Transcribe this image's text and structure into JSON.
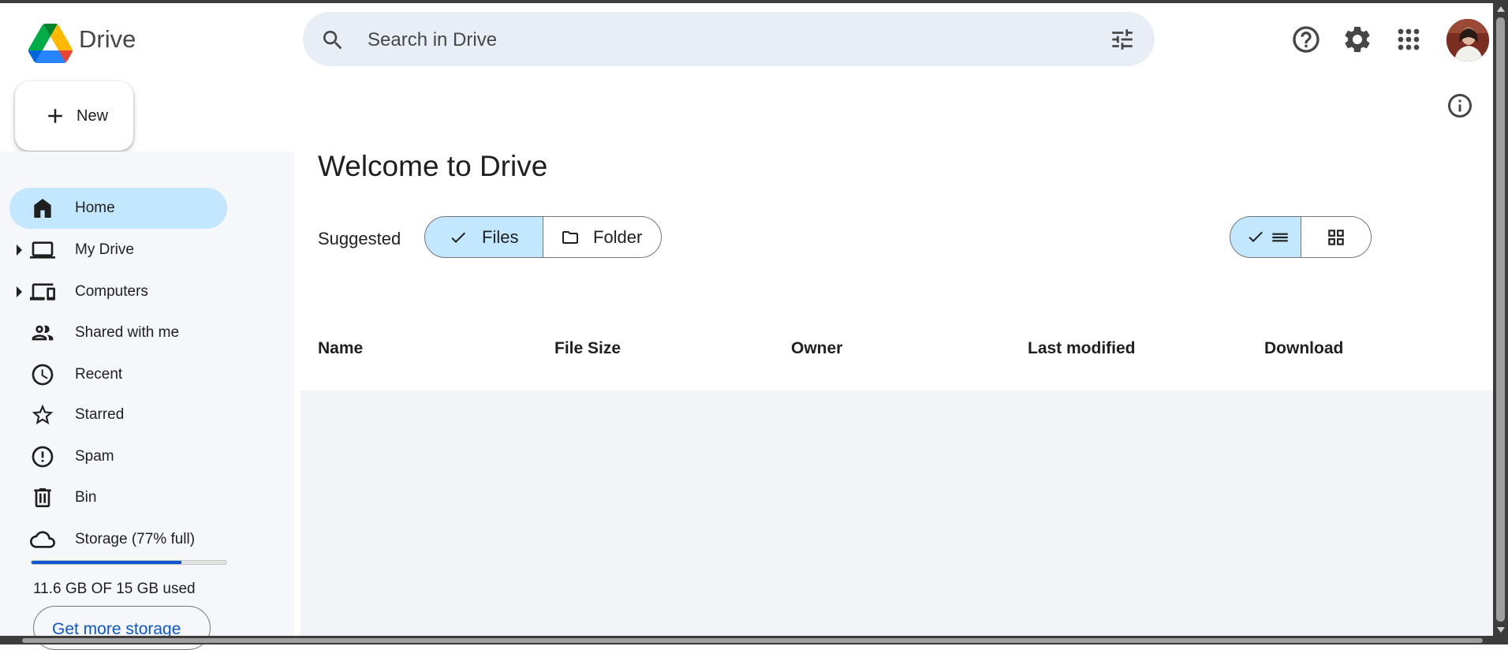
{
  "app": {
    "name": "Drive"
  },
  "search": {
    "placeholder": "Search in Drive"
  },
  "new_button": {
    "label": "New"
  },
  "sidebar": {
    "items": [
      {
        "label": "Home",
        "icon": "home-icon",
        "active": true
      },
      {
        "label": "My Drive",
        "icon": "laptop-icon",
        "expandable": true
      },
      {
        "label": "Computers",
        "icon": "devices-icon",
        "expandable": true
      },
      {
        "label": "Shared with me",
        "icon": "people-icon"
      },
      {
        "label": "Recent",
        "icon": "clock-icon"
      },
      {
        "label": "Starred",
        "icon": "star-icon"
      },
      {
        "label": "Spam",
        "icon": "report-icon"
      },
      {
        "label": "Bin",
        "icon": "trash-icon"
      },
      {
        "label": "Storage (77% full)",
        "icon": "cloud-icon"
      }
    ],
    "storage": {
      "percent_full": 77,
      "used_text": "11.6 GB OF 15 GB used",
      "cta": "Get more storage"
    }
  },
  "main": {
    "title": "Welcome to Drive",
    "suggested_label": "Suggested",
    "filter": {
      "files": "Files",
      "folder": "Folder",
      "selected": "Files"
    },
    "view_mode": {
      "selected": "list"
    },
    "columns": [
      "Name",
      "File Size",
      "Owner",
      "Last modified",
      "Download"
    ]
  },
  "colors": {
    "accent": "#0b57d0",
    "selected_bg": "#c2e7ff",
    "search_bg": "#e9eef6"
  }
}
